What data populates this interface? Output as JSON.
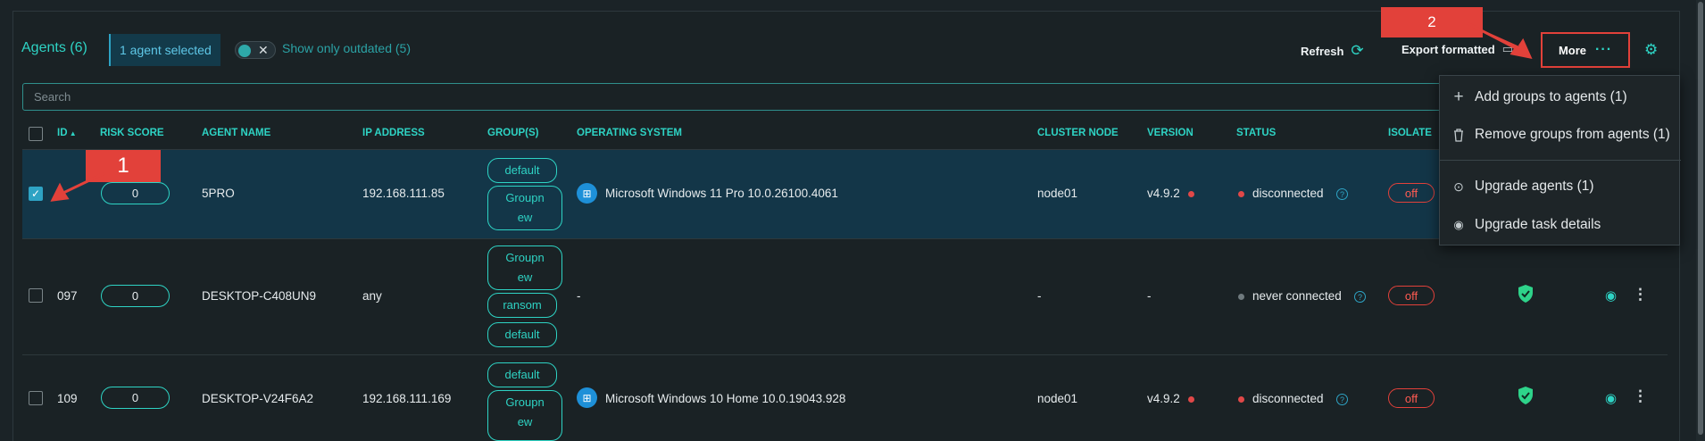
{
  "header": {
    "title": "Agents (6)",
    "selected_label": "1 agent selected",
    "toggle_x": "✕",
    "toggle_label": "Show only outdated (5)",
    "refresh_label": "Refresh",
    "export_label": "Export formatted",
    "more_label": "More",
    "more_dots": "···"
  },
  "search": {
    "placeholder": "Search"
  },
  "columns": [
    "ID",
    "RISK SCORE",
    "AGENT NAME",
    "IP ADDRESS",
    "GROUP(S)",
    "OPERATING SYSTEM",
    "CLUSTER NODE",
    "VERSION",
    "STATUS",
    "ISOLATE"
  ],
  "rows": [
    {
      "id": "",
      "risk": "0",
      "name": "5PRO",
      "ip": "192.168.111.85",
      "groups": [
        "default",
        "Groupn\new"
      ],
      "os": "Microsoft Windows 11 Pro 10.0.26100.4061",
      "node": "node01",
      "version": "v4.9.2",
      "status": "disconnected",
      "isolate": "off",
      "selected": true
    },
    {
      "id": "097",
      "risk": "0",
      "name": "DESKTOP-C408UN9",
      "ip": "any",
      "groups": [
        "Groupn\new",
        "ransom",
        "default"
      ],
      "os": "-",
      "node": "-",
      "version": "-",
      "status": "never connected",
      "isolate": "off",
      "selected": false
    },
    {
      "id": "109",
      "risk": "0",
      "name": "DESKTOP-V24F6A2",
      "ip": "192.168.111.169",
      "groups": [
        "default",
        "Groupn\new"
      ],
      "os": "Microsoft Windows 10 Home 10.0.19043.928",
      "node": "node01",
      "version": "v4.9.2",
      "status": "disconnected",
      "isolate": "off",
      "selected": false
    }
  ],
  "more_menu": {
    "items": [
      {
        "icon": "plus-icon",
        "label": "Add groups to agents (1)"
      },
      {
        "icon": "trash-icon",
        "label": "Remove groups from agents (1)"
      },
      {
        "icon": "upgrade-icon",
        "label": "Upgrade agents (1)"
      },
      {
        "icon": "eye-icon",
        "label": "Upgrade task details"
      }
    ]
  },
  "annotations": {
    "callout_1": "1",
    "callout_2": "2"
  },
  "colors": {
    "accent": "#2ed3c4",
    "selected_row": "#133648",
    "danger": "#e2413a",
    "disconnected_dot": "#e04848",
    "never_connected_dot": "#6f7a7e",
    "shield": "#2ed38a"
  }
}
